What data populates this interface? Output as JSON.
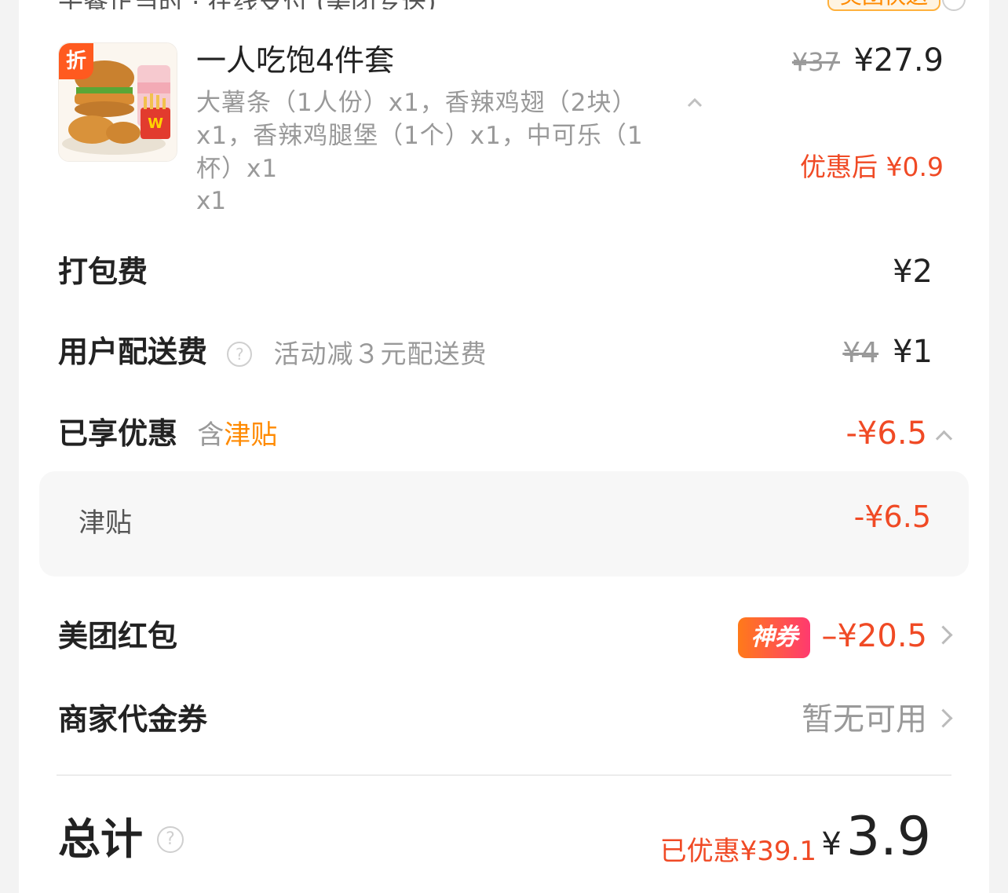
{
  "top_row": {
    "left_text": "午餐正当时 · 在线支付 (美团专送)",
    "badge": "美团快送",
    "help_icon": "help-icon"
  },
  "product": {
    "discount_tag": "折",
    "name": "一人吃饱4件套",
    "description": "大薯条（1人份）x1，香辣鸡翅（2块）x1，香辣鸡腿堡（1个）x1，中可乐（1杯）x1",
    "quantity": "x1",
    "price_original": "¥37",
    "price_current": "¥27.9",
    "price_after_discount": "优惠后 ¥0.9",
    "collapse_icon": "chevron-up-icon"
  },
  "packing_fee": {
    "label": "打包费",
    "value": "¥2"
  },
  "delivery_fee": {
    "label": "用户配送费",
    "help": "?",
    "note": "活动减３元配送费",
    "old_value": "¥4",
    "value": "¥1"
  },
  "discounts": {
    "label": "已享优惠",
    "sub_prefix": "含",
    "sub_highlight": "津贴",
    "value": "-¥6.5",
    "detail": {
      "label": "津贴",
      "value": "-¥6.5"
    }
  },
  "red_packet": {
    "label": "美团红包",
    "badge": "神券",
    "value": "–¥20.5"
  },
  "merchant_voucher": {
    "label": "商家代金券",
    "value": "暂无可用"
  },
  "total": {
    "label": "总计",
    "help": "?",
    "saved": "已优惠¥39.1",
    "currency": "¥",
    "amount": "3.9"
  },
  "colors": {
    "accent_red": "#f04a25",
    "accent_orange": "#ff8a00",
    "muted_text": "#999999"
  }
}
